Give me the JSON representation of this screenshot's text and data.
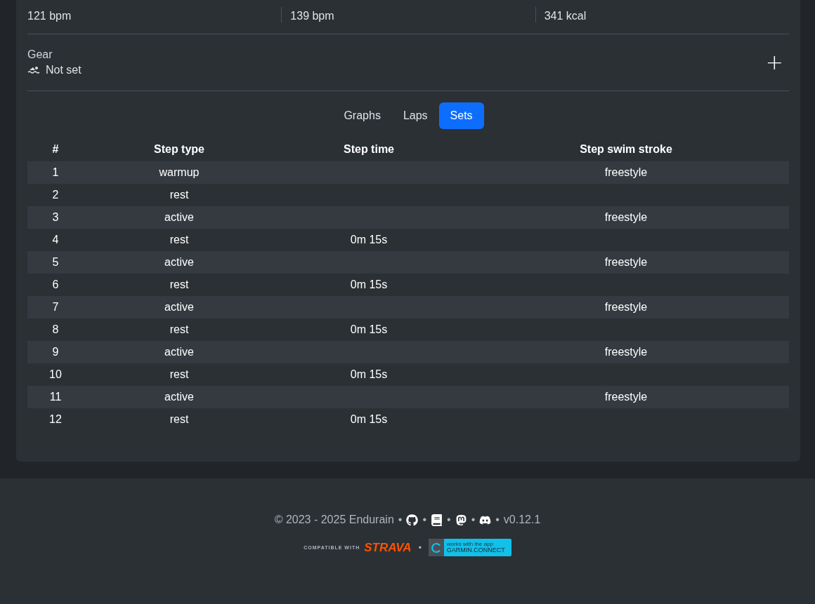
{
  "stats": [
    {
      "value": "121 bpm"
    },
    {
      "value": "139 bpm"
    },
    {
      "value": "341 kcal"
    }
  ],
  "gear": {
    "label": "Gear",
    "value": "Not set",
    "add_symbol": "+"
  },
  "tabs": [
    {
      "label": "Graphs",
      "selected": false
    },
    {
      "label": "Laps",
      "selected": false
    },
    {
      "label": "Sets",
      "selected": true
    }
  ],
  "table": {
    "columns": [
      "#",
      "Step type",
      "Step time",
      "Step swim stroke"
    ],
    "rows": [
      [
        "1",
        "warmup",
        "",
        "freestyle"
      ],
      [
        "2",
        "rest",
        "",
        ""
      ],
      [
        "3",
        "active",
        "",
        "freestyle"
      ],
      [
        "4",
        "rest",
        "0m 15s",
        ""
      ],
      [
        "5",
        "active",
        "",
        "freestyle"
      ],
      [
        "6",
        "rest",
        "0m 15s",
        ""
      ],
      [
        "7",
        "active",
        "",
        "freestyle"
      ],
      [
        "8",
        "rest",
        "0m 15s",
        ""
      ],
      [
        "9",
        "active",
        "",
        "freestyle"
      ],
      [
        "10",
        "rest",
        "0m 15s",
        ""
      ],
      [
        "11",
        "active",
        "",
        "freestyle"
      ],
      [
        "12",
        "rest",
        "0m 15s",
        ""
      ]
    ]
  },
  "footer": {
    "copyright": "© 2023 - 2025 Endurain",
    "separator": "•",
    "links": [
      {
        "kind": "github"
      },
      {
        "kind": "docs"
      },
      {
        "kind": "mastodon"
      },
      {
        "kind": "discord"
      }
    ],
    "version": "v0.12.1",
    "strava": {
      "prefix": "COMPATIBLE WITH",
      "brand": "STRAVA"
    },
    "garmin": {
      "tagline": "works with the app",
      "brand": "GARMIN.CONNECT"
    }
  }
}
